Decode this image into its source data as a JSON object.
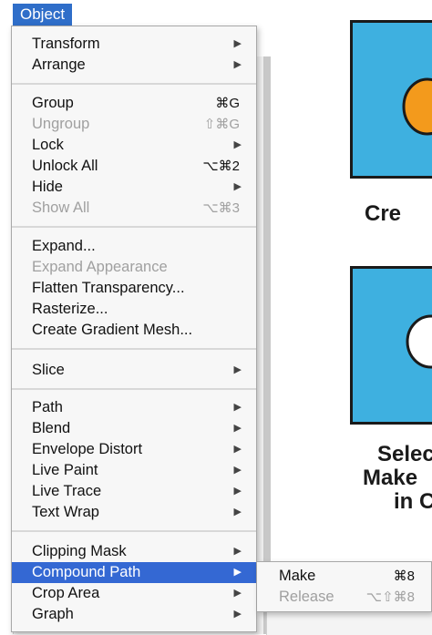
{
  "menu": {
    "title": "Object",
    "items": [
      {
        "label": "Transform",
        "shortcut": "",
        "has_submenu": true,
        "disabled": false
      },
      {
        "label": "Arrange",
        "shortcut": "",
        "has_submenu": true,
        "disabled": false
      },
      {
        "label": "Group",
        "shortcut": "⌘G",
        "has_submenu": false,
        "disabled": false
      },
      {
        "label": "Ungroup",
        "shortcut": "⇧⌘G",
        "has_submenu": false,
        "disabled": true
      },
      {
        "label": "Lock",
        "shortcut": "",
        "has_submenu": true,
        "disabled": false
      },
      {
        "label": "Unlock All",
        "shortcut": "⌥⌘2",
        "has_submenu": false,
        "disabled": false
      },
      {
        "label": "Hide",
        "shortcut": "",
        "has_submenu": true,
        "disabled": false
      },
      {
        "label": "Show All",
        "shortcut": "⌥⌘3",
        "has_submenu": false,
        "disabled": true
      },
      {
        "label": "Expand...",
        "shortcut": "",
        "has_submenu": false,
        "disabled": false
      },
      {
        "label": "Expand Appearance",
        "shortcut": "",
        "has_submenu": false,
        "disabled": true
      },
      {
        "label": "Flatten Transparency...",
        "shortcut": "",
        "has_submenu": false,
        "disabled": false
      },
      {
        "label": "Rasterize...",
        "shortcut": "",
        "has_submenu": false,
        "disabled": false
      },
      {
        "label": "Create Gradient Mesh...",
        "shortcut": "",
        "has_submenu": false,
        "disabled": false
      },
      {
        "label": "Slice",
        "shortcut": "",
        "has_submenu": true,
        "disabled": false
      },
      {
        "label": "Path",
        "shortcut": "",
        "has_submenu": true,
        "disabled": false
      },
      {
        "label": "Blend",
        "shortcut": "",
        "has_submenu": true,
        "disabled": false
      },
      {
        "label": "Envelope Distort",
        "shortcut": "",
        "has_submenu": true,
        "disabled": false
      },
      {
        "label": "Live Paint",
        "shortcut": "",
        "has_submenu": true,
        "disabled": false
      },
      {
        "label": "Live Trace",
        "shortcut": "",
        "has_submenu": true,
        "disabled": false
      },
      {
        "label": "Text Wrap",
        "shortcut": "",
        "has_submenu": true,
        "disabled": false
      },
      {
        "label": "Clipping Mask",
        "shortcut": "",
        "has_submenu": true,
        "disabled": false
      },
      {
        "label": "Compound Path",
        "shortcut": "",
        "has_submenu": true,
        "disabled": false,
        "selected": true
      },
      {
        "label": "Crop Area",
        "shortcut": "",
        "has_submenu": true,
        "disabled": false
      },
      {
        "label": "Graph",
        "shortcut": "",
        "has_submenu": true,
        "disabled": false
      }
    ]
  },
  "submenu": {
    "items": [
      {
        "label": "Make",
        "shortcut": "⌘8",
        "disabled": false
      },
      {
        "label": "Release",
        "shortcut": "⌥⇧⌘8",
        "disabled": true
      }
    ]
  },
  "background": {
    "caption1": "Cre",
    "caption2_line1": "Selec",
    "caption2_line2": "Make",
    "caption2_line3": "in C"
  },
  "colors": {
    "accent": "#3468d3",
    "menu_title_bg": "#2f6ec9",
    "illustration_blue": "#3eb0e0",
    "illustration_orange": "#f39a1c"
  },
  "icons": {
    "submenu_arrow": "▶"
  }
}
